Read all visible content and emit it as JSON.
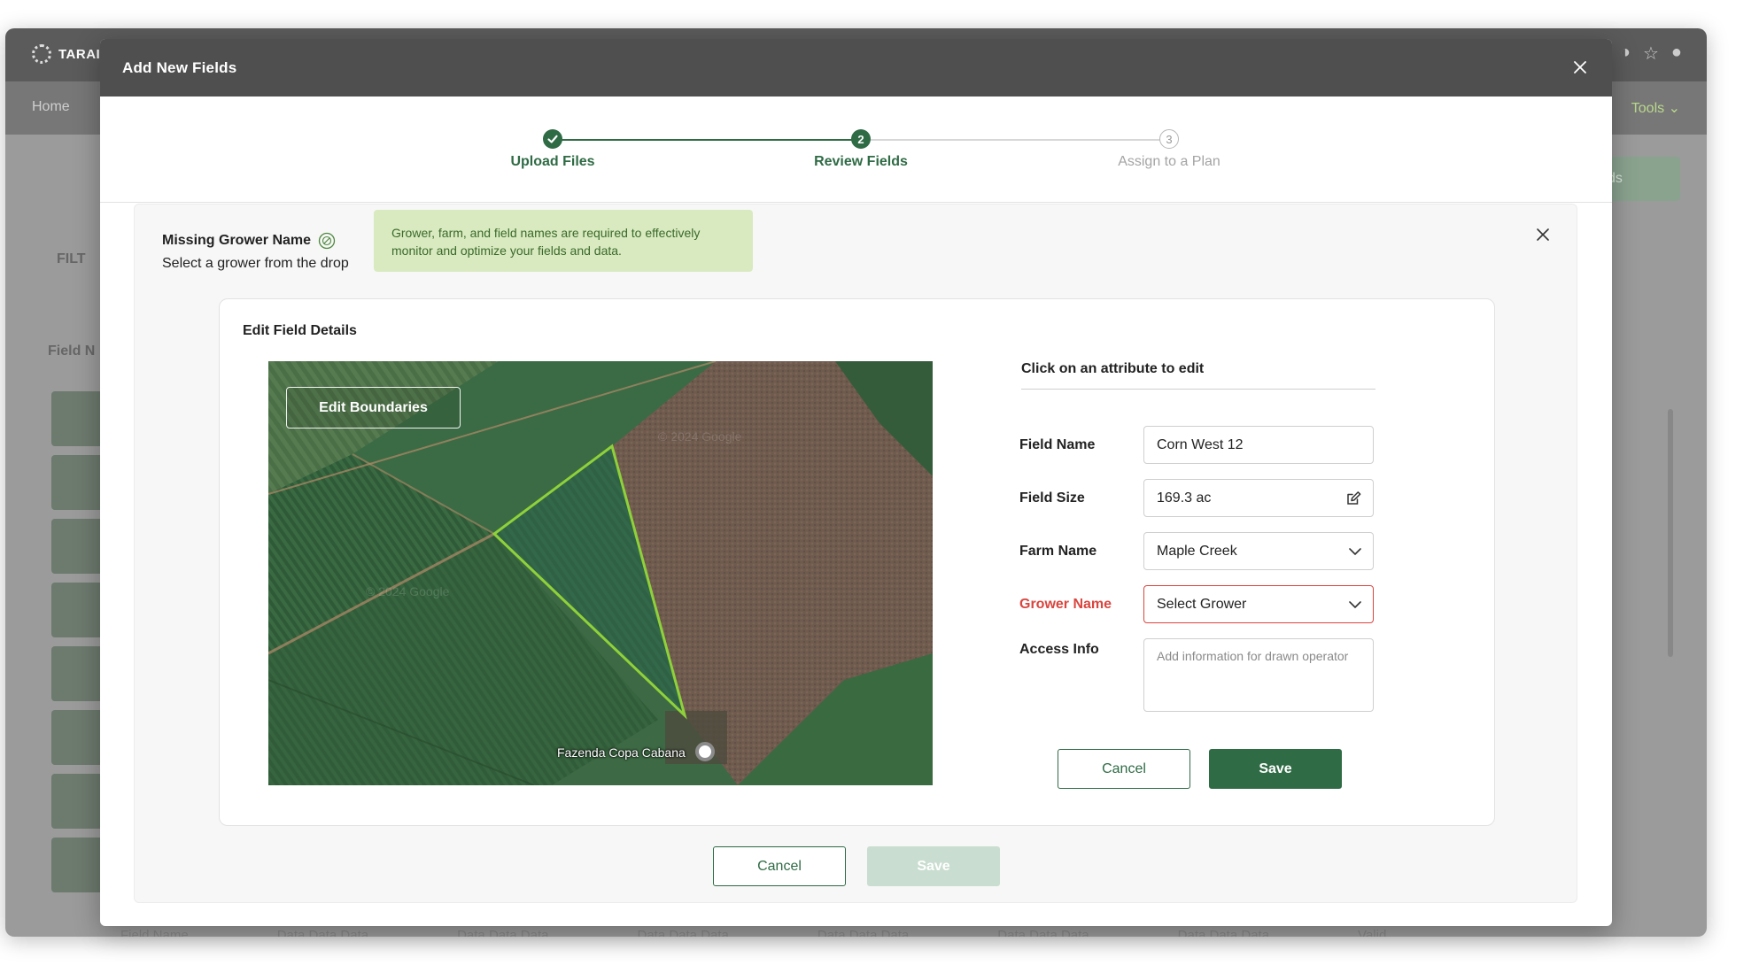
{
  "background_app": {
    "logo_text": "TARAI",
    "nav_home": "Home",
    "nav_tools": "Tools",
    "add_button_partial": "ields",
    "filter_partial": "FILT",
    "field_name_partial": "Field N",
    "footer_columns": [
      "Field Name",
      "Data Data Data",
      "Data Data Data",
      "Data Data Data",
      "Data Data Data",
      "Data Data Data",
      "Data Data Data",
      "Valid"
    ]
  },
  "modal": {
    "title": "Add New Fields",
    "steps": [
      {
        "number": "1",
        "label": "Upload Files",
        "state": "done"
      },
      {
        "number": "2",
        "label": "Review Fields",
        "state": "active"
      },
      {
        "number": "3",
        "label": "Assign to a Plan",
        "state": "todo"
      }
    ]
  },
  "alert": {
    "title": "Missing Grower Name",
    "subtitle": "Select a grower from the drop",
    "tooltip": "Grower, farm, and field names are required to effectively monitor and optimize your fields and data."
  },
  "edit_card": {
    "title": "Edit Field Details",
    "edit_boundaries_label": "Edit Boundaries",
    "map_place_label": "Fazenda Copa Cabana",
    "attributes_header": "Click on an attribute to edit",
    "fields": {
      "field_name": {
        "label": "Field Name",
        "value": "Corn West 12"
      },
      "field_size": {
        "label": "Field Size",
        "value": "169.3 ac"
      },
      "farm_name": {
        "label": "Farm Name",
        "value": "Maple Creek"
      },
      "grower_name": {
        "label": "Grower Name",
        "value": "Select Grower"
      },
      "access_info": {
        "label": "Access Info",
        "placeholder": "Add information for drawn operator"
      }
    },
    "cancel_label": "Cancel",
    "save_label": "Save"
  },
  "footer": {
    "cancel_label": "Cancel",
    "save_label": "Save"
  },
  "colors": {
    "primary_green": "#2f6b45",
    "error_red": "#d9463f",
    "tooltip_bg": "#d9eac0",
    "field_outline": "#8fd13a"
  }
}
